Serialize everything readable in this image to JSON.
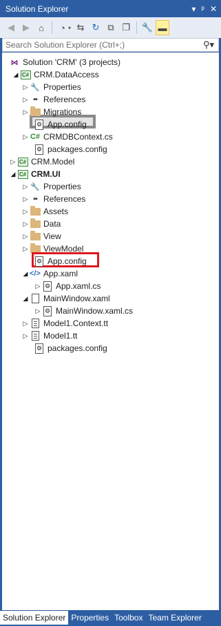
{
  "window": {
    "title": "Solution Explorer",
    "controls": [
      "▾",
      "ᵖ",
      "✕"
    ]
  },
  "search": {
    "placeholder": "Search Solution Explorer (Ctrl+;)"
  },
  "tree": {
    "solution": "Solution 'CRM' (3 projects)",
    "dataaccess": {
      "name": "CRM.DataAccess",
      "properties": "Properties",
      "references": "References",
      "migrations": "Migrations",
      "appconfig": "App.config",
      "context": "CRMDBContext.cs",
      "packages": "packages.config"
    },
    "model": {
      "name": "CRM.Model"
    },
    "ui": {
      "name": "CRM.UI",
      "properties": "Properties",
      "references": "References",
      "assets": "Assets",
      "data": "Data",
      "view": "View",
      "viewmodel": "ViewModel",
      "appconfig": "App.config",
      "appxaml": "App.xaml",
      "appxamlcs": "App.xaml.cs",
      "mainwindow": "MainWindow.xaml",
      "mainwindowcs": "MainWindow.xaml.cs",
      "model1context": "Model1.Context.tt",
      "model1": "Model1.tt",
      "packages": "packages.config"
    }
  },
  "tabs": [
    {
      "label": "Solution Explorer",
      "active": true
    },
    {
      "label": "Properties",
      "active": false
    },
    {
      "label": "Toolbox",
      "active": false
    },
    {
      "label": "Team Explorer",
      "active": false
    }
  ],
  "colors": {
    "frame": "#2d5ea3",
    "highlight_red": "#e0171f",
    "highlight_gray": "#8a8a8a"
  }
}
